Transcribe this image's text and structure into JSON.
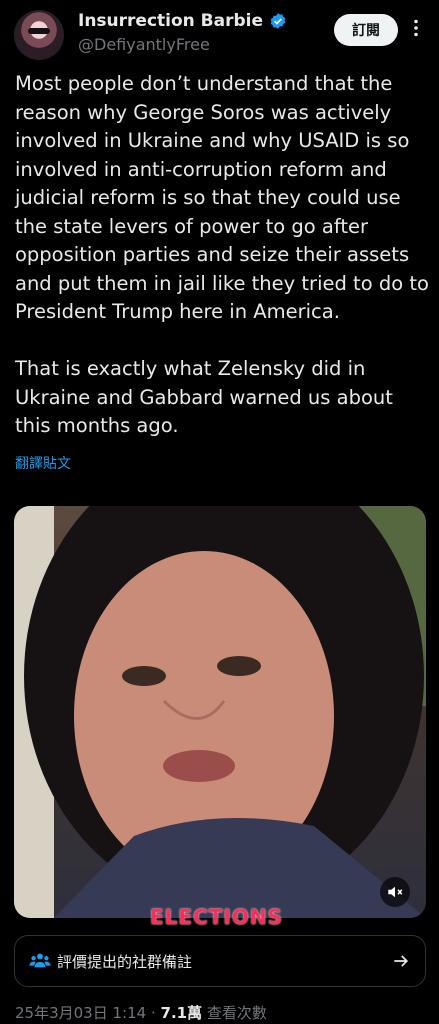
{
  "author": {
    "display_name": "Insurrection Barbie",
    "handle": "@DefiyantlyFree",
    "verified": true,
    "badge_color": "#1d9bf0"
  },
  "header": {
    "subscribe_label": "訂閱",
    "more_icon": "more-dots-icon"
  },
  "tweet": {
    "paragraphs": [
      "Most people don’t understand that the reason why George Soros was actively involved in Ukraine and why USAID is so involved in anti-corruption reform and judicial reform is so that they could use the state levers of power to go after opposition parties and seize their assets and put them in jail like they tried to do to President Trump here in America.",
      "That is exactly what Zelensky did in Ukraine and Gabbard warned us about this months ago."
    ],
    "translate_label": "翻譯貼文"
  },
  "media": {
    "type": "video",
    "mute_icon": "muted-speaker-icon",
    "overlay_caption": "ELECTIONS"
  },
  "community_notes": {
    "label": "評價提出的社群備註",
    "icon": "people-icon",
    "arrow_icon": "arrow-right-icon"
  },
  "meta": {
    "timestamp": "25年3月03日 1:14",
    "separator": "·",
    "views_count": "7.1萬",
    "views_label": "查看次數"
  }
}
